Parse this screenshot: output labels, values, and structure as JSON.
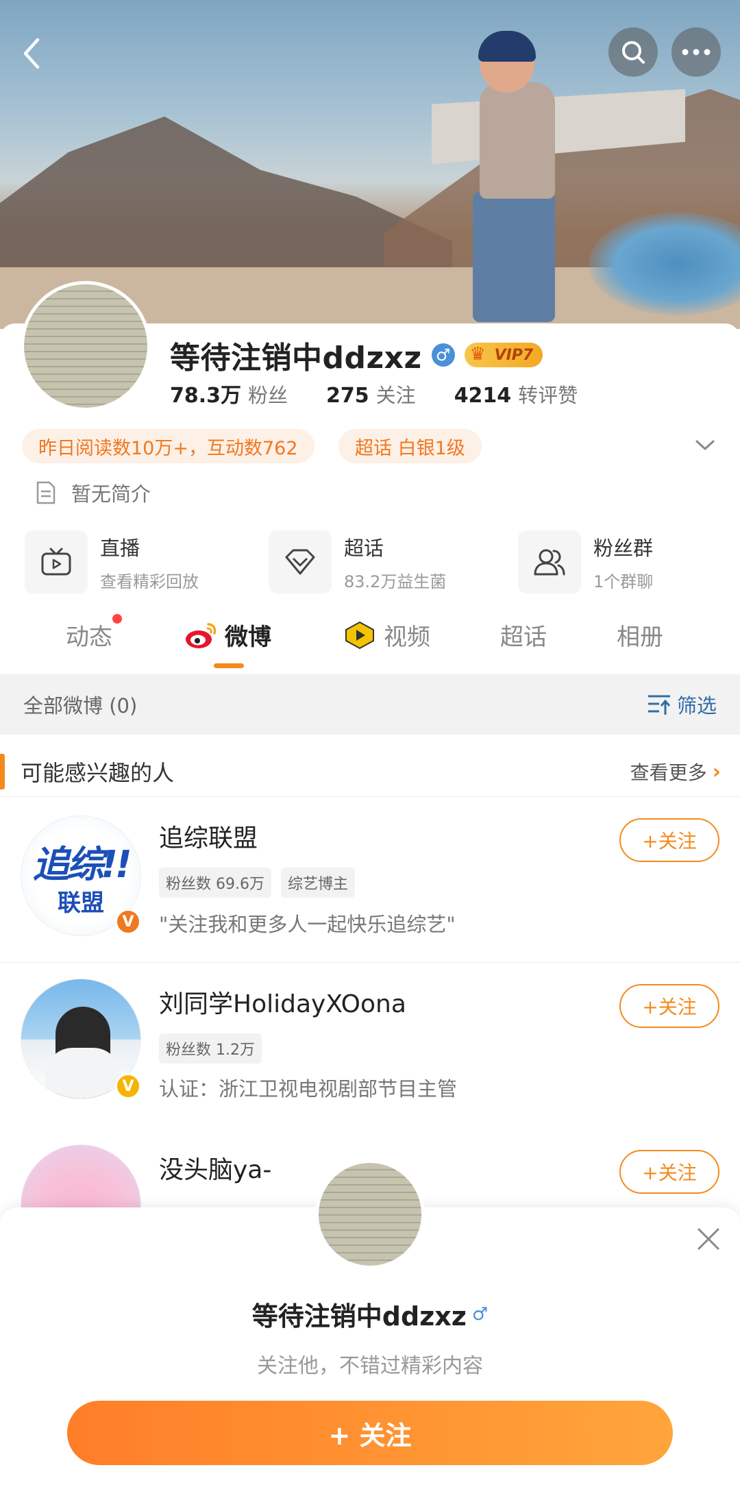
{
  "profile": {
    "name": "等待注销中ddzxz",
    "gender_symbol": "♂",
    "vip_label": "VIP7",
    "stats": [
      {
        "num": "78.3万",
        "label": "粉丝"
      },
      {
        "num": "275",
        "label": "关注"
      },
      {
        "num": "4214",
        "label": "转评赞"
      }
    ],
    "tags": [
      "昨日阅读数10万+，互动数762",
      "超话 白银1级"
    ],
    "bio": "暂无简介"
  },
  "features": [
    {
      "title": "直播",
      "sub": "查看精彩回放",
      "icon": "tv-play-icon"
    },
    {
      "title": "超话",
      "sub": "83.2万益生菌",
      "icon": "diamond-icon"
    },
    {
      "title": "粉丝群",
      "sub": "1个群聊",
      "icon": "group-icon"
    }
  ],
  "tabs": [
    "动态",
    "微博",
    "视频",
    "超话",
    "相册"
  ],
  "active_tab": "微博",
  "filter_bar": {
    "count_label": "全部微博 (0)",
    "filter_label": "筛选"
  },
  "interest": {
    "title": "可能感兴趣的人",
    "more_label": "查看更多"
  },
  "suggested_users": [
    {
      "name": "追综联盟",
      "tags": [
        "粉丝数 69.6万",
        "综艺博主"
      ],
      "desc": "\"关注我和更多人一起快乐追综艺\"",
      "avatar_text_1": "追综!!",
      "avatar_text_2": "联盟",
      "follow_label": "+关注"
    },
    {
      "name": "刘同学HolidayXOona",
      "tags": [
        "粉丝数 1.2万"
      ],
      "desc": "认证：浙江卫视电视剧部节目主管",
      "follow_label": "+关注"
    },
    {
      "name": "没头脑ya-",
      "tags": [],
      "desc": "",
      "follow_label": "+关注"
    }
  ],
  "sheet": {
    "name": "等待注销中ddzxz",
    "gender_symbol": "♂",
    "subtitle": "关注他，不错过精彩内容",
    "follow_label": "+ 关注"
  },
  "colors": {
    "accent_orange": "#f48a1c",
    "link_blue": "#2f6ea6",
    "verified_orange": "#f07820",
    "verified_yellow": "#f5b400"
  }
}
